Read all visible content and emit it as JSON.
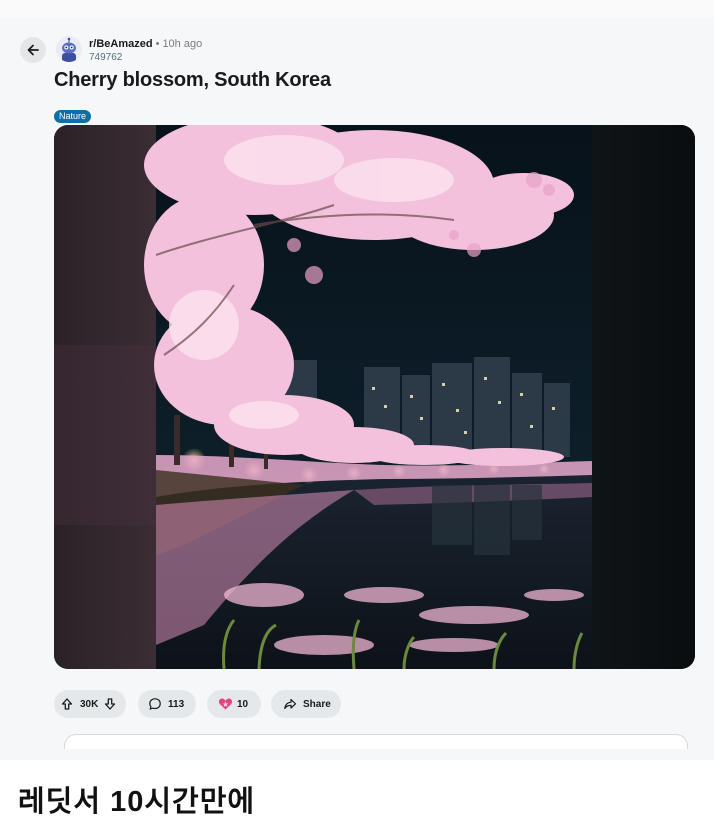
{
  "post": {
    "subreddit": "r/BeAmazed",
    "separator": "•",
    "time": "10h ago",
    "user": "749762",
    "title": "Cherry blossom, South Korea",
    "flair": "Nature"
  },
  "actions": {
    "upvotes": "30K",
    "comments": "113",
    "awards": "10",
    "share": "Share"
  },
  "caption": "레딧서 10시간만에",
  "icons": [
    "back-arrow-icon",
    "snoo-avatar-icon",
    "upvote-icon",
    "downvote-icon",
    "comment-icon",
    "award-heart-icon",
    "share-icon"
  ],
  "colors": {
    "flair": "#0e6ea8",
    "pill": "#e5e8ea",
    "blossom": "#f3c1dc",
    "night_sky": "#0b1622"
  }
}
